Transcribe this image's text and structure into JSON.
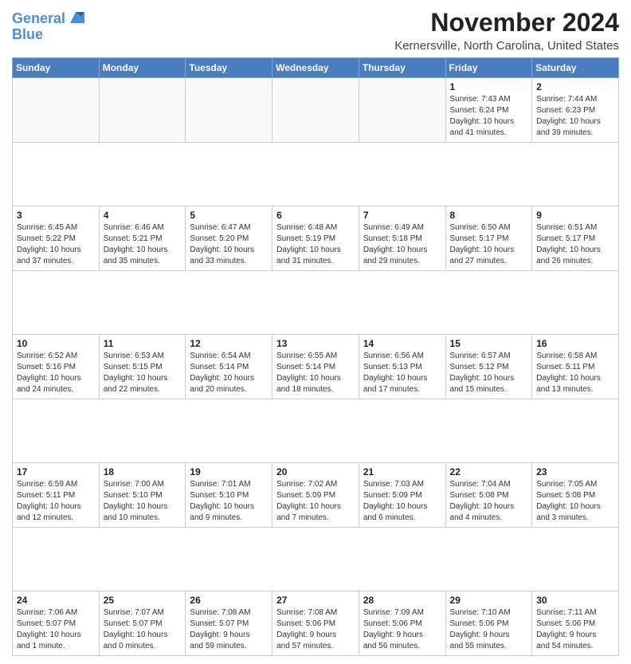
{
  "logo": {
    "line1": "General",
    "line2": "Blue"
  },
  "title": "November 2024",
  "subtitle": "Kernersville, North Carolina, United States",
  "days_of_week": [
    "Sunday",
    "Monday",
    "Tuesday",
    "Wednesday",
    "Thursday",
    "Friday",
    "Saturday"
  ],
  "weeks": [
    [
      {
        "day": "",
        "info": ""
      },
      {
        "day": "",
        "info": ""
      },
      {
        "day": "",
        "info": ""
      },
      {
        "day": "",
        "info": ""
      },
      {
        "day": "",
        "info": ""
      },
      {
        "day": "1",
        "info": "Sunrise: 7:43 AM\nSunset: 6:24 PM\nDaylight: 10 hours\nand 41 minutes."
      },
      {
        "day": "2",
        "info": "Sunrise: 7:44 AM\nSunset: 6:23 PM\nDaylight: 10 hours\nand 39 minutes."
      }
    ],
    [
      {
        "day": "3",
        "info": "Sunrise: 6:45 AM\nSunset: 5:22 PM\nDaylight: 10 hours\nand 37 minutes."
      },
      {
        "day": "4",
        "info": "Sunrise: 6:46 AM\nSunset: 5:21 PM\nDaylight: 10 hours\nand 35 minutes."
      },
      {
        "day": "5",
        "info": "Sunrise: 6:47 AM\nSunset: 5:20 PM\nDaylight: 10 hours\nand 33 minutes."
      },
      {
        "day": "6",
        "info": "Sunrise: 6:48 AM\nSunset: 5:19 PM\nDaylight: 10 hours\nand 31 minutes."
      },
      {
        "day": "7",
        "info": "Sunrise: 6:49 AM\nSunset: 5:18 PM\nDaylight: 10 hours\nand 29 minutes."
      },
      {
        "day": "8",
        "info": "Sunrise: 6:50 AM\nSunset: 5:17 PM\nDaylight: 10 hours\nand 27 minutes."
      },
      {
        "day": "9",
        "info": "Sunrise: 6:51 AM\nSunset: 5:17 PM\nDaylight: 10 hours\nand 26 minutes."
      }
    ],
    [
      {
        "day": "10",
        "info": "Sunrise: 6:52 AM\nSunset: 5:16 PM\nDaylight: 10 hours\nand 24 minutes."
      },
      {
        "day": "11",
        "info": "Sunrise: 6:53 AM\nSunset: 5:15 PM\nDaylight: 10 hours\nand 22 minutes."
      },
      {
        "day": "12",
        "info": "Sunrise: 6:54 AM\nSunset: 5:14 PM\nDaylight: 10 hours\nand 20 minutes."
      },
      {
        "day": "13",
        "info": "Sunrise: 6:55 AM\nSunset: 5:14 PM\nDaylight: 10 hours\nand 18 minutes."
      },
      {
        "day": "14",
        "info": "Sunrise: 6:56 AM\nSunset: 5:13 PM\nDaylight: 10 hours\nand 17 minutes."
      },
      {
        "day": "15",
        "info": "Sunrise: 6:57 AM\nSunset: 5:12 PM\nDaylight: 10 hours\nand 15 minutes."
      },
      {
        "day": "16",
        "info": "Sunrise: 6:58 AM\nSunset: 5:11 PM\nDaylight: 10 hours\nand 13 minutes."
      }
    ],
    [
      {
        "day": "17",
        "info": "Sunrise: 6:59 AM\nSunset: 5:11 PM\nDaylight: 10 hours\nand 12 minutes."
      },
      {
        "day": "18",
        "info": "Sunrise: 7:00 AM\nSunset: 5:10 PM\nDaylight: 10 hours\nand 10 minutes."
      },
      {
        "day": "19",
        "info": "Sunrise: 7:01 AM\nSunset: 5:10 PM\nDaylight: 10 hours\nand 9 minutes."
      },
      {
        "day": "20",
        "info": "Sunrise: 7:02 AM\nSunset: 5:09 PM\nDaylight: 10 hours\nand 7 minutes."
      },
      {
        "day": "21",
        "info": "Sunrise: 7:03 AM\nSunset: 5:09 PM\nDaylight: 10 hours\nand 6 minutes."
      },
      {
        "day": "22",
        "info": "Sunrise: 7:04 AM\nSunset: 5:08 PM\nDaylight: 10 hours\nand 4 minutes."
      },
      {
        "day": "23",
        "info": "Sunrise: 7:05 AM\nSunset: 5:08 PM\nDaylight: 10 hours\nand 3 minutes."
      }
    ],
    [
      {
        "day": "24",
        "info": "Sunrise: 7:06 AM\nSunset: 5:07 PM\nDaylight: 10 hours\nand 1 minute."
      },
      {
        "day": "25",
        "info": "Sunrise: 7:07 AM\nSunset: 5:07 PM\nDaylight: 10 hours\nand 0 minutes."
      },
      {
        "day": "26",
        "info": "Sunrise: 7:08 AM\nSunset: 5:07 PM\nDaylight: 9 hours\nand 59 minutes."
      },
      {
        "day": "27",
        "info": "Sunrise: 7:08 AM\nSunset: 5:06 PM\nDaylight: 9 hours\nand 57 minutes."
      },
      {
        "day": "28",
        "info": "Sunrise: 7:09 AM\nSunset: 5:06 PM\nDaylight: 9 hours\nand 56 minutes."
      },
      {
        "day": "29",
        "info": "Sunrise: 7:10 AM\nSunset: 5:06 PM\nDaylight: 9 hours\nand 55 minutes."
      },
      {
        "day": "30",
        "info": "Sunrise: 7:11 AM\nSunset: 5:06 PM\nDaylight: 9 hours\nand 54 minutes."
      }
    ]
  ]
}
